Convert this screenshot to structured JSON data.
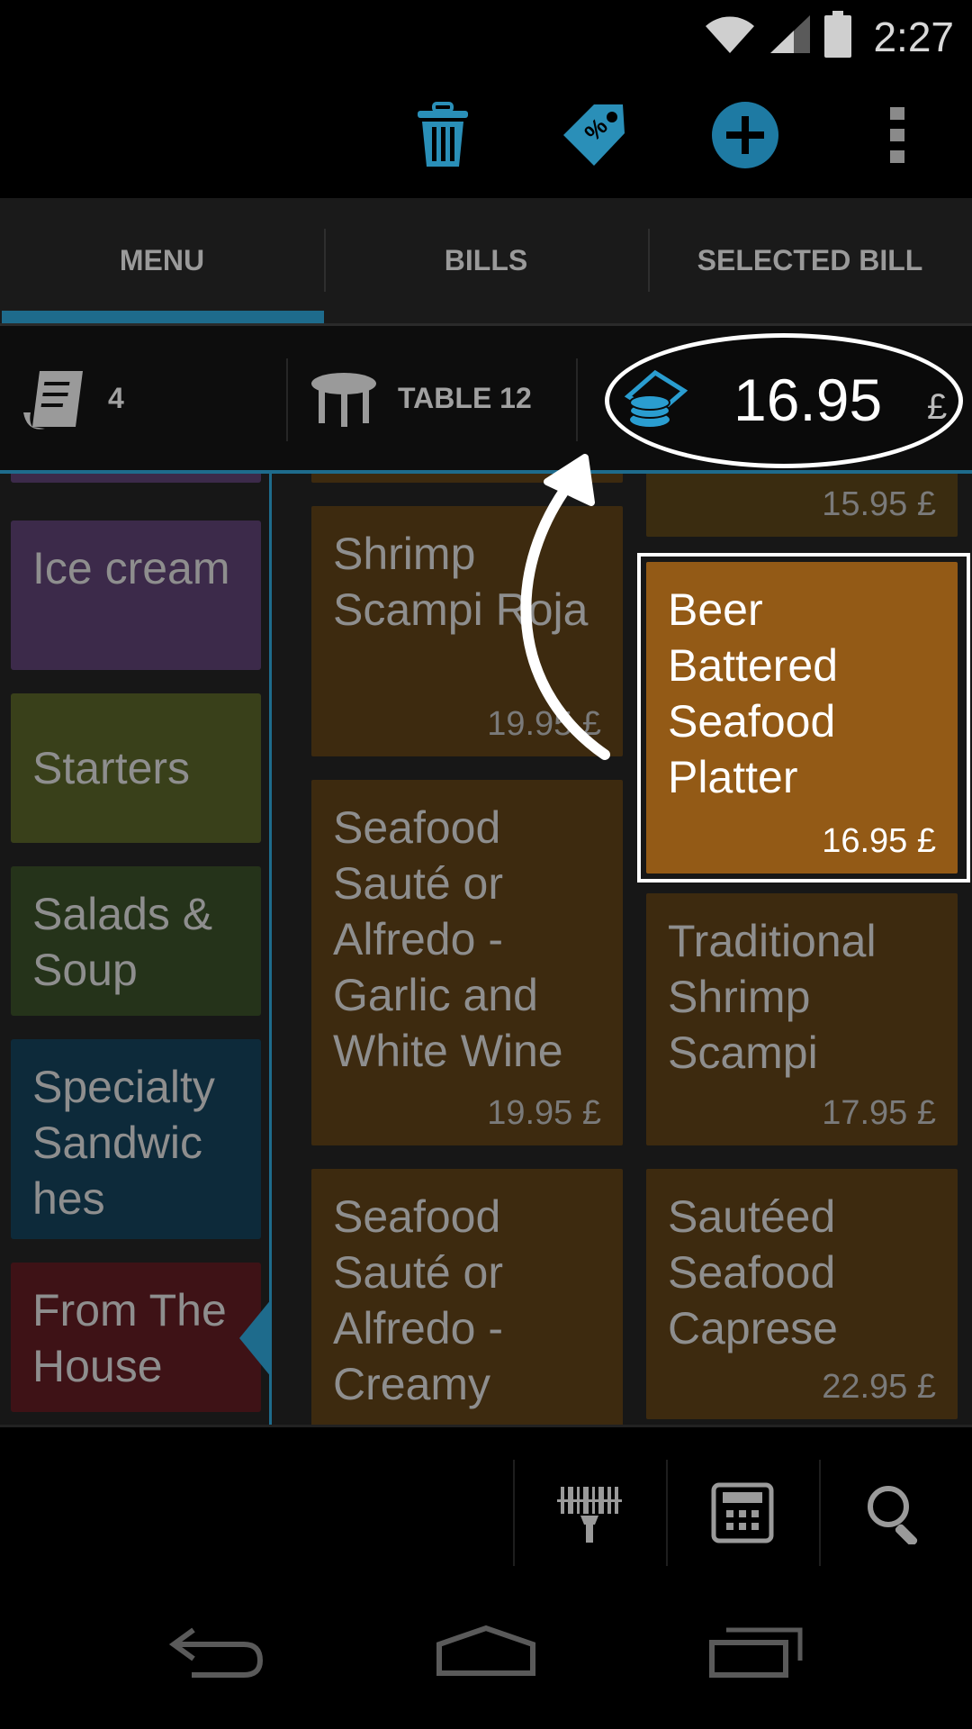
{
  "status": {
    "time": "2:27",
    "icons": [
      "wifi-icon",
      "signal-icon",
      "battery-icon"
    ]
  },
  "actionbar": {
    "icons": [
      "trash-icon",
      "discount-tag-icon",
      "add-icon",
      "overflow-menu-icon"
    ]
  },
  "tabs": [
    {
      "label": "MENU",
      "active": true
    },
    {
      "label": "BILLS",
      "active": false
    },
    {
      "label": "SELECTED BILL",
      "active": false
    }
  ],
  "info": {
    "receipt_count": "4",
    "table_label": "TABLE 12",
    "total": "16.95",
    "currency": "£"
  },
  "categories": [
    {
      "label": "Ice cream",
      "color": "#3c2a4a"
    },
    {
      "label": "Starters",
      "color": "#39401a"
    },
    {
      "label": "Salads & Soup",
      "color": "#25331a"
    },
    {
      "label": "Specialty Sandwic hes",
      "color": "#0d2a3a"
    },
    {
      "label": "From The House",
      "color": "#3e1216"
    }
  ],
  "items": [
    {
      "name": "",
      "price": "15.95 £"
    },
    {
      "name": "Shrimp Scampi Roja",
      "price": "19.95 £"
    },
    {
      "name": "Beer Battered Seafood Platter",
      "price": "16.95 £",
      "selected": true
    },
    {
      "name": "Seafood Sauté or Alfredo - Garlic and White Wine",
      "price": "19.95 £"
    },
    {
      "name": "Traditional Shrimp Scampi",
      "price": "17.95 £"
    },
    {
      "name": "Seafood Sauté or Alfredo - Creamy",
      "price": ""
    },
    {
      "name": "Sautéed Seafood Caprese",
      "price": "22.95 £"
    }
  ],
  "colors": {
    "accent": "#1e6b8c",
    "item_dim": "#3d2a0f",
    "item_selected": "#935a16"
  },
  "toolbar": {
    "icons": [
      "barcode-scanner-icon",
      "calculator-icon",
      "search-icon"
    ]
  },
  "navbar": {
    "icons": [
      "back-icon",
      "home-icon",
      "recent-apps-icon"
    ]
  }
}
